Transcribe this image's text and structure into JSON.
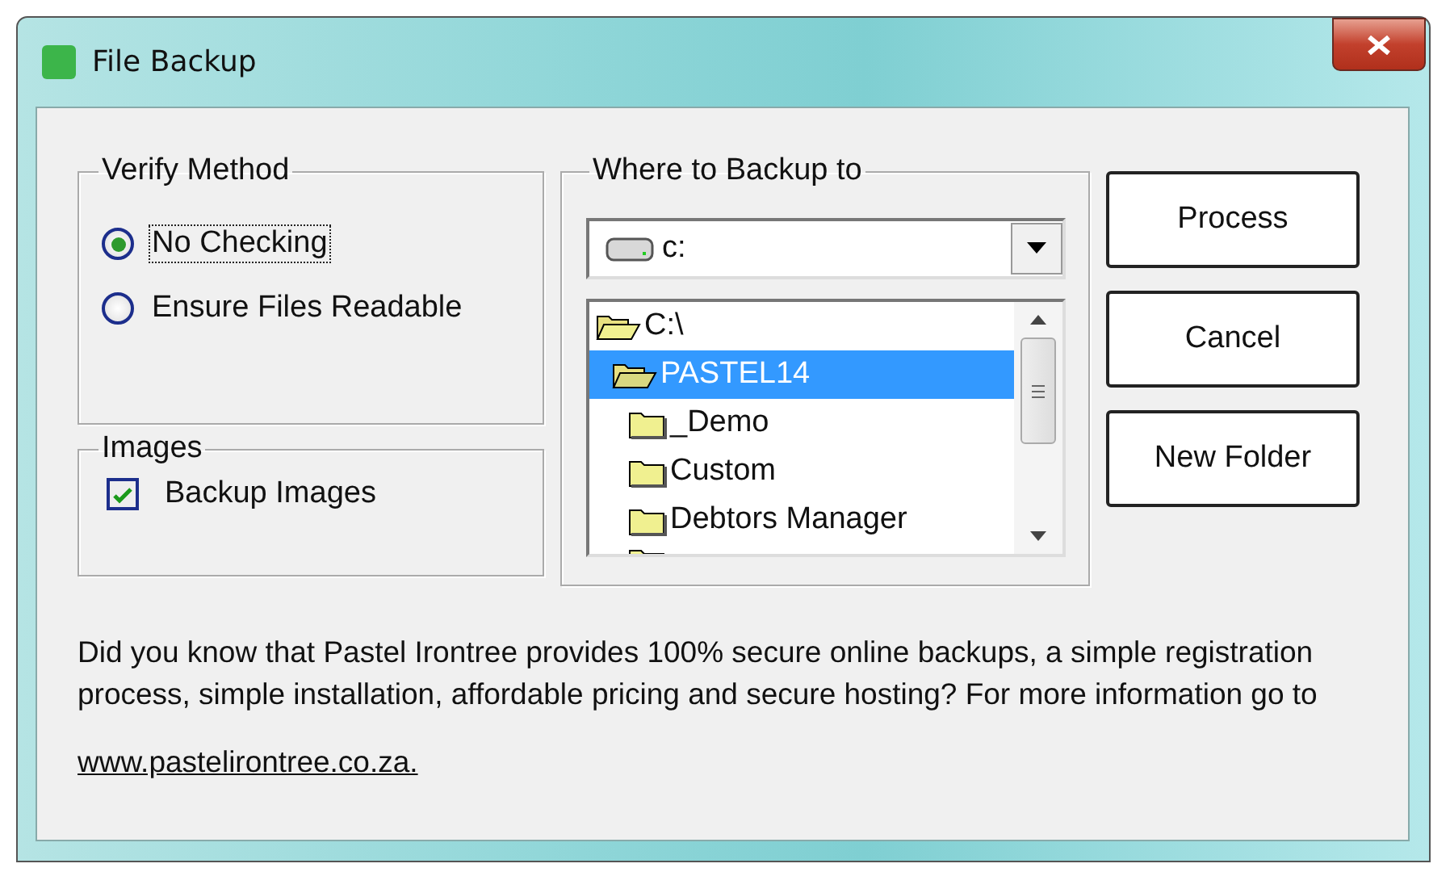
{
  "window": {
    "title": "File Backup"
  },
  "verify_method": {
    "title": "Verify Method",
    "options": [
      {
        "label": "No Checking",
        "selected": true,
        "focused": true
      },
      {
        "label": "Ensure Files Readable",
        "selected": false,
        "focused": false
      }
    ]
  },
  "images": {
    "title": "Images",
    "checkbox": {
      "label": "Backup Images",
      "checked": true
    }
  },
  "destination": {
    "title": "Where to Backup to",
    "drive": {
      "value": "c:"
    },
    "tree": [
      {
        "label": "C:\\",
        "expanded": true,
        "selected": false,
        "children": [
          {
            "label": "PASTEL14",
            "expanded": true,
            "selected": true,
            "children": [
              {
                "label": "_Demo",
                "expanded": false,
                "selected": false
              },
              {
                "label": "Custom",
                "expanded": false,
                "selected": false
              },
              {
                "label": "Debtors Manager",
                "expanded": false,
                "selected": false
              },
              {
                "selected": false
              }
            ]
          }
        ]
      }
    ]
  },
  "buttons": [
    {
      "label": "Process"
    },
    {
      "label": "Cancel"
    },
    {
      "label": "New Folder"
    }
  ],
  "info": {
    "text": "Did you know that Pastel Irontree provides 100% secure online backups, a simple registration process, simple installation, affordable pricing and secure hosting? For more information go to",
    "link": "www.pastelirontree.co.za."
  }
}
